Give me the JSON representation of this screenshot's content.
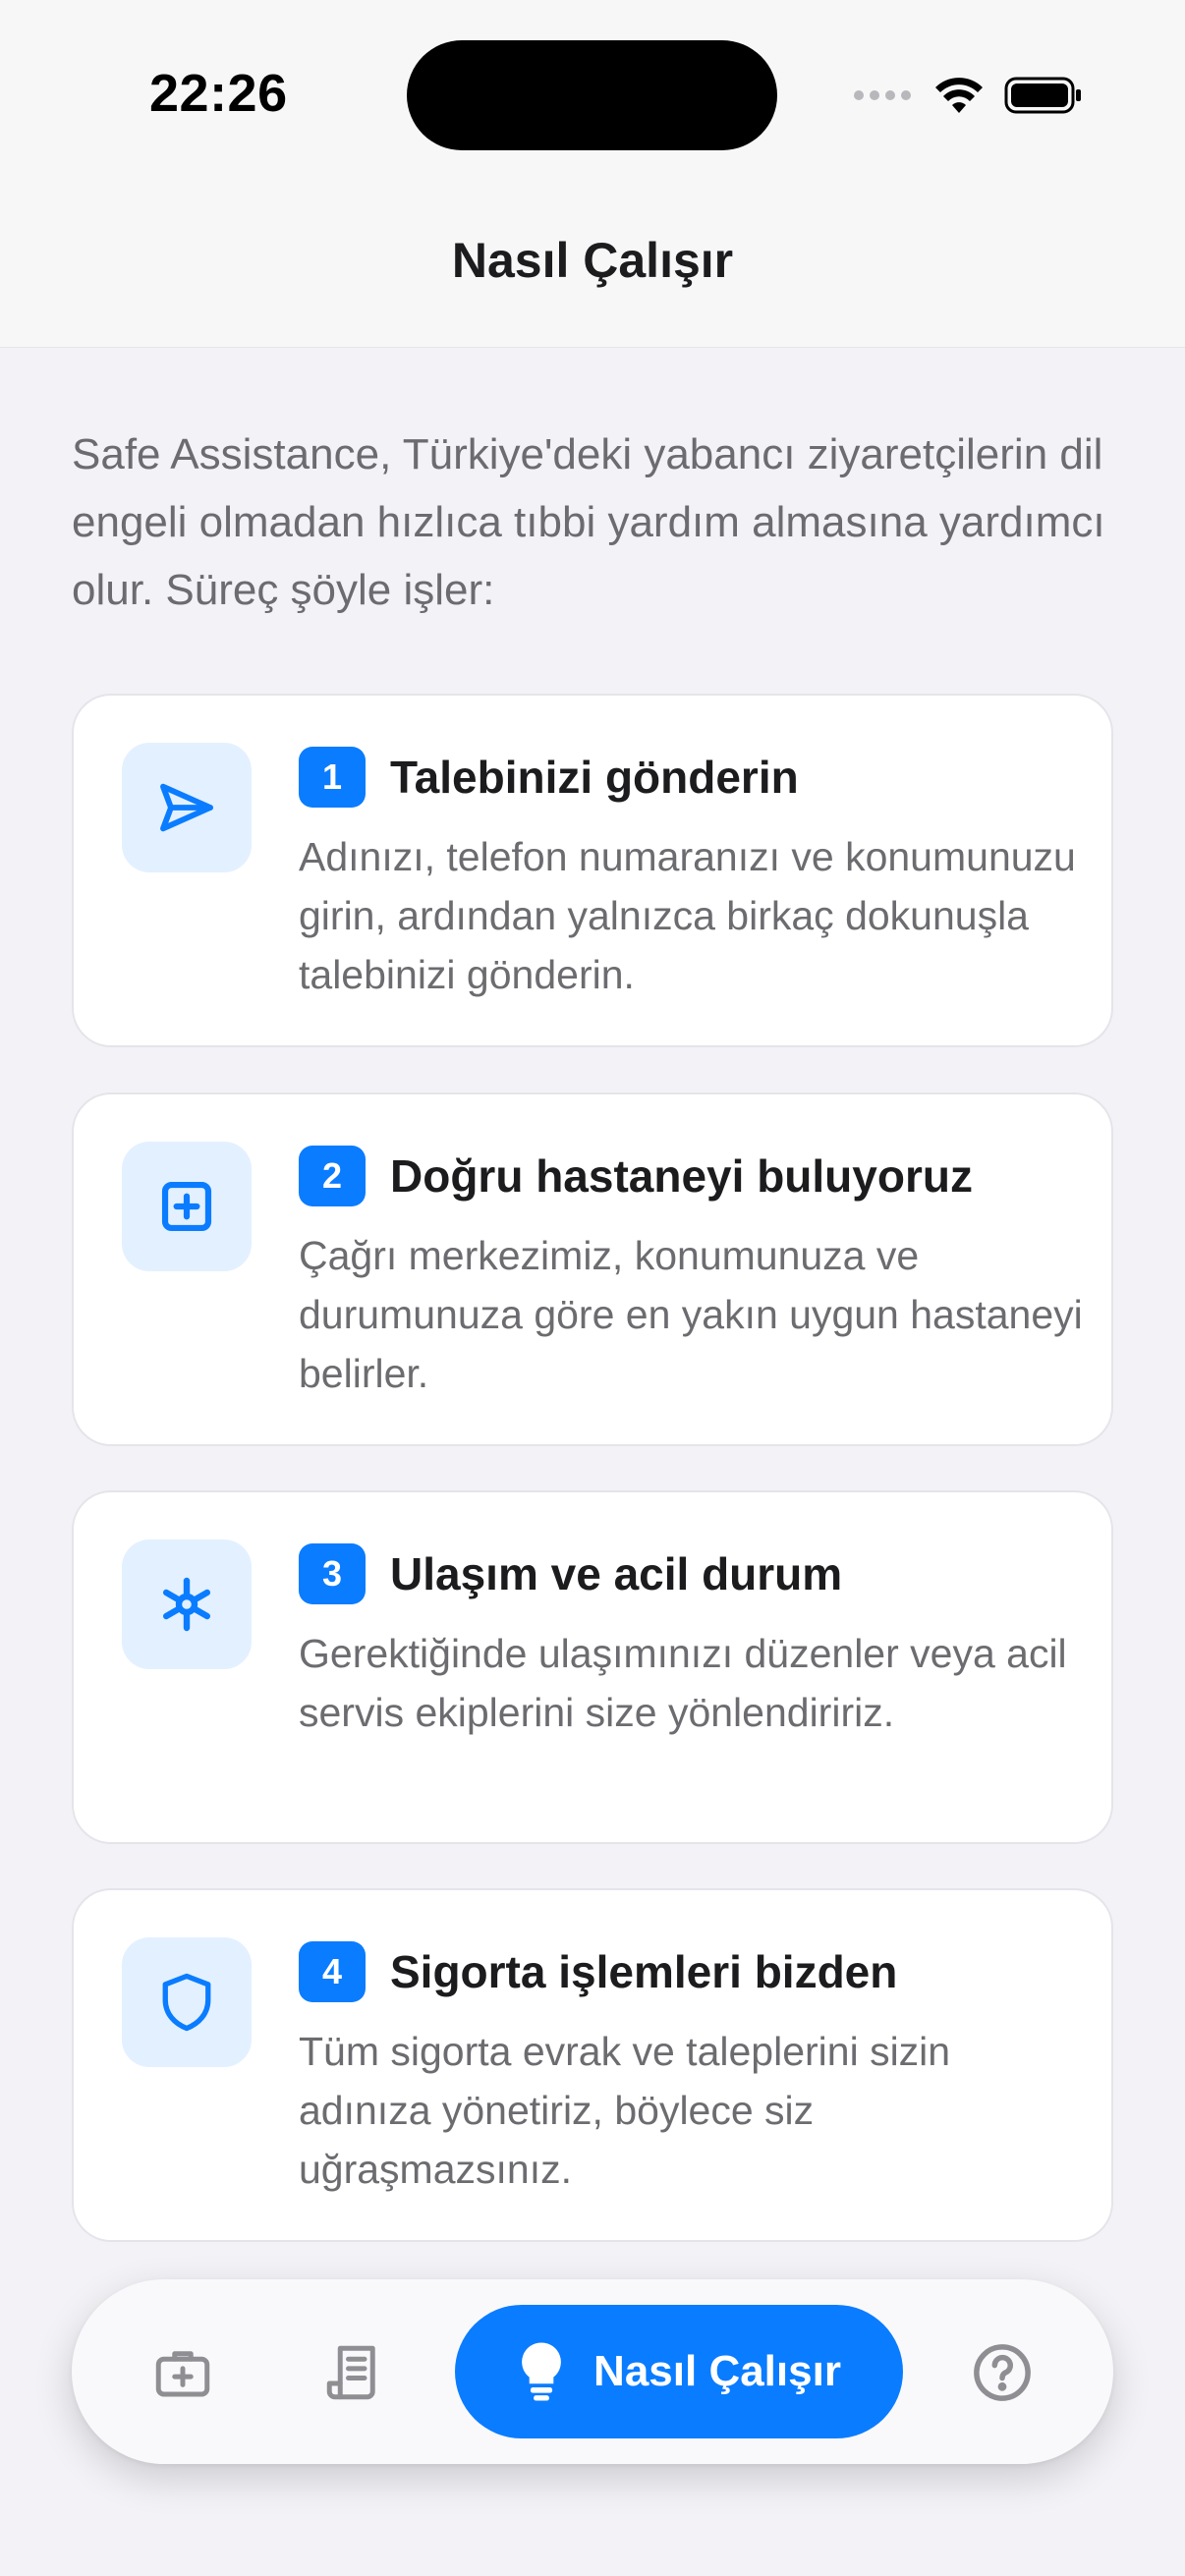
{
  "status_bar": {
    "time": "22:26"
  },
  "nav": {
    "title": "Nasıl Çalışır"
  },
  "intro": "Safe Assistance, Türkiye'deki yabancı ziyaretçilerin dil engeli olmadan hızlıca tıbbi yardım almasına yardımcı olur. Süreç şöyle işler:",
  "steps": [
    {
      "number": "1",
      "title": "Talebinizi gönderin",
      "description": "Adınızı, telefon numaranızı ve konumunuzu girin, ardından yalnızca birkaç dokunuşla talebinizi gönderin.",
      "icon": "send-icon"
    },
    {
      "number": "2",
      "title": "Doğru hastaneyi buluyoruz",
      "description": "Çağrı merkezimiz, konumunuza ve durumunuza göre en yakın uygun hastaneyi belirler.",
      "icon": "medical-plus-icon"
    },
    {
      "number": "3",
      "title": "Ulaşım ve acil durum",
      "description": "Gerektiğinde ulaşımınızı düzenler veya acil servis ekiplerini size yönlendiririz.",
      "icon": "asterisk-icon"
    },
    {
      "number": "4",
      "title": "Sigorta işlemleri bizden",
      "description": "Tüm sigorta evrak ve taleplerini sizin adınıza yönetiriz, böylece siz uğraşmazsınız.",
      "icon": "shield-icon"
    }
  ],
  "tab_bar": {
    "items": [
      {
        "icon": "medical-kit-icon"
      },
      {
        "icon": "receipt-icon"
      },
      {
        "icon": "lightbulb-icon",
        "label": "Nasıl Çalışır",
        "active": true
      },
      {
        "icon": "help-icon"
      }
    ]
  },
  "colors": {
    "accent": "#0a7cff",
    "icon_bg": "#e3f0ff",
    "background": "#f2f2f7"
  }
}
